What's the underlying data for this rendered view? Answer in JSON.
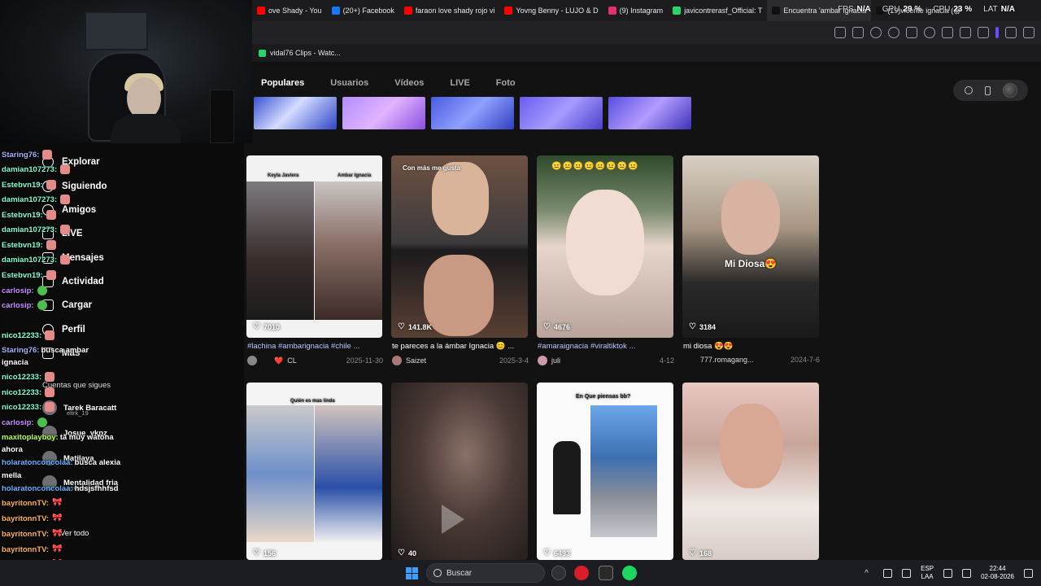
{
  "browser": {
    "tabs": [
      {
        "label": "ove Shady - You",
        "color": "#ff0000"
      },
      {
        "label": "(20+) Facebook",
        "color": "#1877f2"
      },
      {
        "label": "faraon love shady rojo vi",
        "color": "#ff0000"
      },
      {
        "label": "Yovng Benny - LUJO & D",
        "color": "#ff0000"
      },
      {
        "label": "(9) Instagram",
        "color": "#e1306c"
      },
      {
        "label": "javicontrerasf_Official: T",
        "color": "#27d36a"
      },
      {
        "label": "Encuentra 'ambar ignacia",
        "color": "#111111",
        "active": true
      },
      {
        "label": "(19)vicente ignacia (@",
        "color": "#111111"
      }
    ],
    "bookmark": "vidal76 Clips - Watc..."
  },
  "perf": {
    "fps_label": "FPS",
    "fps": "N/A",
    "gpu_label": "GPU",
    "gpu": "29 %",
    "cpu_label": "CPU",
    "cpu": "23 %",
    "lat_label": "LAT",
    "lat": "N/A"
  },
  "search_tabs": [
    "Populares",
    "Usuarios",
    "Vídeos",
    "LIVE",
    "Foto"
  ],
  "sidebar": {
    "items": [
      "Explorar",
      "Siguiendo",
      "Amigos",
      "LIVE",
      "Mensajes",
      "Actividad",
      "Cargar",
      "Perfil",
      "Más"
    ],
    "followed_heading": "Cuentas que sigues",
    "followed": [
      {
        "name": "Tarek Baracatt",
        "handle": "eltrk_19"
      },
      {
        "name": "Josue_ykpz",
        "handle": ""
      },
      {
        "name": "Matilaya",
        "handle": ""
      },
      {
        "name": "Mentalidad fria",
        "handle": "nnvtnieljjj.77"
      }
    ],
    "see_all": "Ver todo"
  },
  "videos_row1": [
    {
      "likes": "7010",
      "caption": "#lachina #ambarignacia #chile ...",
      "author": "CL",
      "date": "2025-11-30",
      "overlay_left": "Keyla Javiera",
      "overlay_right": "Ambar Ignacia"
    },
    {
      "likes": "141.8K",
      "caption": "te pareces a la ámbar Ignacia 😊 ...",
      "author": "Saizet",
      "date": "2025-3-4",
      "overlay": "Con más me gusta"
    },
    {
      "likes": "4676",
      "caption": "#amaraignacia #viraltiktok ...",
      "author": "juli",
      "date": "4-12"
    },
    {
      "likes": "3184",
      "caption": "mi diosa 😍😍",
      "author": "777.romagang...",
      "date": "2024-7-6",
      "overlay": "Mi Diosa😍"
    }
  ],
  "videos_row2": [
    {
      "likes": "156",
      "overlay": "Quién es mas linda"
    },
    {
      "likes": "40"
    },
    {
      "likes": "6493",
      "overlay": "En Que piensas bb?"
    },
    {
      "likes": "168"
    }
  ],
  "chat": [
    {
      "user": "Staring76:",
      "color": "#9fb4ff",
      "text": ""
    },
    {
      "user": "damian107273:",
      "color": "#7fffd4",
      "text": ""
    },
    {
      "user": "Estebvn19:",
      "color": "#7fffd4",
      "text": ""
    },
    {
      "user": "damian107273:",
      "color": "#7fffd4",
      "text": ""
    },
    {
      "user": "Estebvn19:",
      "color": "#7fffd4",
      "text": ""
    },
    {
      "user": "damian107273:",
      "color": "#7fffd4",
      "text": ""
    },
    {
      "user": "Estebvn19:",
      "color": "#7fffd4",
      "text": ""
    },
    {
      "user": "damian107273:",
      "color": "#7fffd4",
      "text": ""
    },
    {
      "user": "Estebvn19:",
      "color": "#7fffd4",
      "text": ""
    },
    {
      "user": "carlosip:",
      "color": "#c78bff",
      "text": ""
    },
    {
      "user": "carlosip:",
      "color": "#c78bff",
      "text": ""
    },
    {
      "user": "nico12233:",
      "color": "#7fffd4",
      "text": ""
    },
    {
      "user": "nico12233:",
      "color": "#7fffd4",
      "text": ""
    },
    {
      "user": "Staring76:",
      "color": "#9fb4ff",
      "text": "busca ambar"
    },
    {
      "user": "ignacia",
      "color": "#ffffff",
      "text": ""
    },
    {
      "user": "nico12233:",
      "color": "#7fffd4",
      "text": ""
    },
    {
      "user": "nico12233:",
      "color": "#7fffd4",
      "text": ""
    },
    {
      "user": "nico12233:",
      "color": "#7fffd4",
      "text": ""
    },
    {
      "user": "carlosip:",
      "color": "#c78bff",
      "text": ""
    },
    {
      "user": "maxitoplayboy:",
      "color": "#b6ff4a",
      "text": "ta muy watona"
    },
    {
      "user": "ahora",
      "color": "#ffffff",
      "text": ""
    },
    {
      "user": "holaratonconcolaa:",
      "color": "#5fb3ff",
      "text": "busca alexia"
    },
    {
      "user": "mella",
      "color": "#ffffff",
      "text": ""
    },
    {
      "user": "holaratonconcolaa:",
      "color": "#5fb3ff",
      "text": "hdsjsfhhfsd"
    },
    {
      "user": "bayritonnTV:",
      "color": "#ffb347",
      "text": ""
    },
    {
      "user": "bayritonnTV:",
      "color": "#ffb347",
      "text": ""
    },
    {
      "user": "bayritonnTV:",
      "color": "#ffb347",
      "text": ""
    },
    {
      "user": "bayritonnTV:",
      "color": "#ffb347",
      "text": ""
    },
    {
      "user": "bayritonnTV:",
      "color": "#ffb347",
      "text": ""
    },
    {
      "user": "bayritonnTV:",
      "color": "#ffb347",
      "text": ""
    }
  ],
  "taskbar": {
    "search_placeholder": "Buscar",
    "lang_top": "ESP",
    "lang_bottom": "LAA",
    "time": "22:44",
    "date": "02-08-2026"
  }
}
